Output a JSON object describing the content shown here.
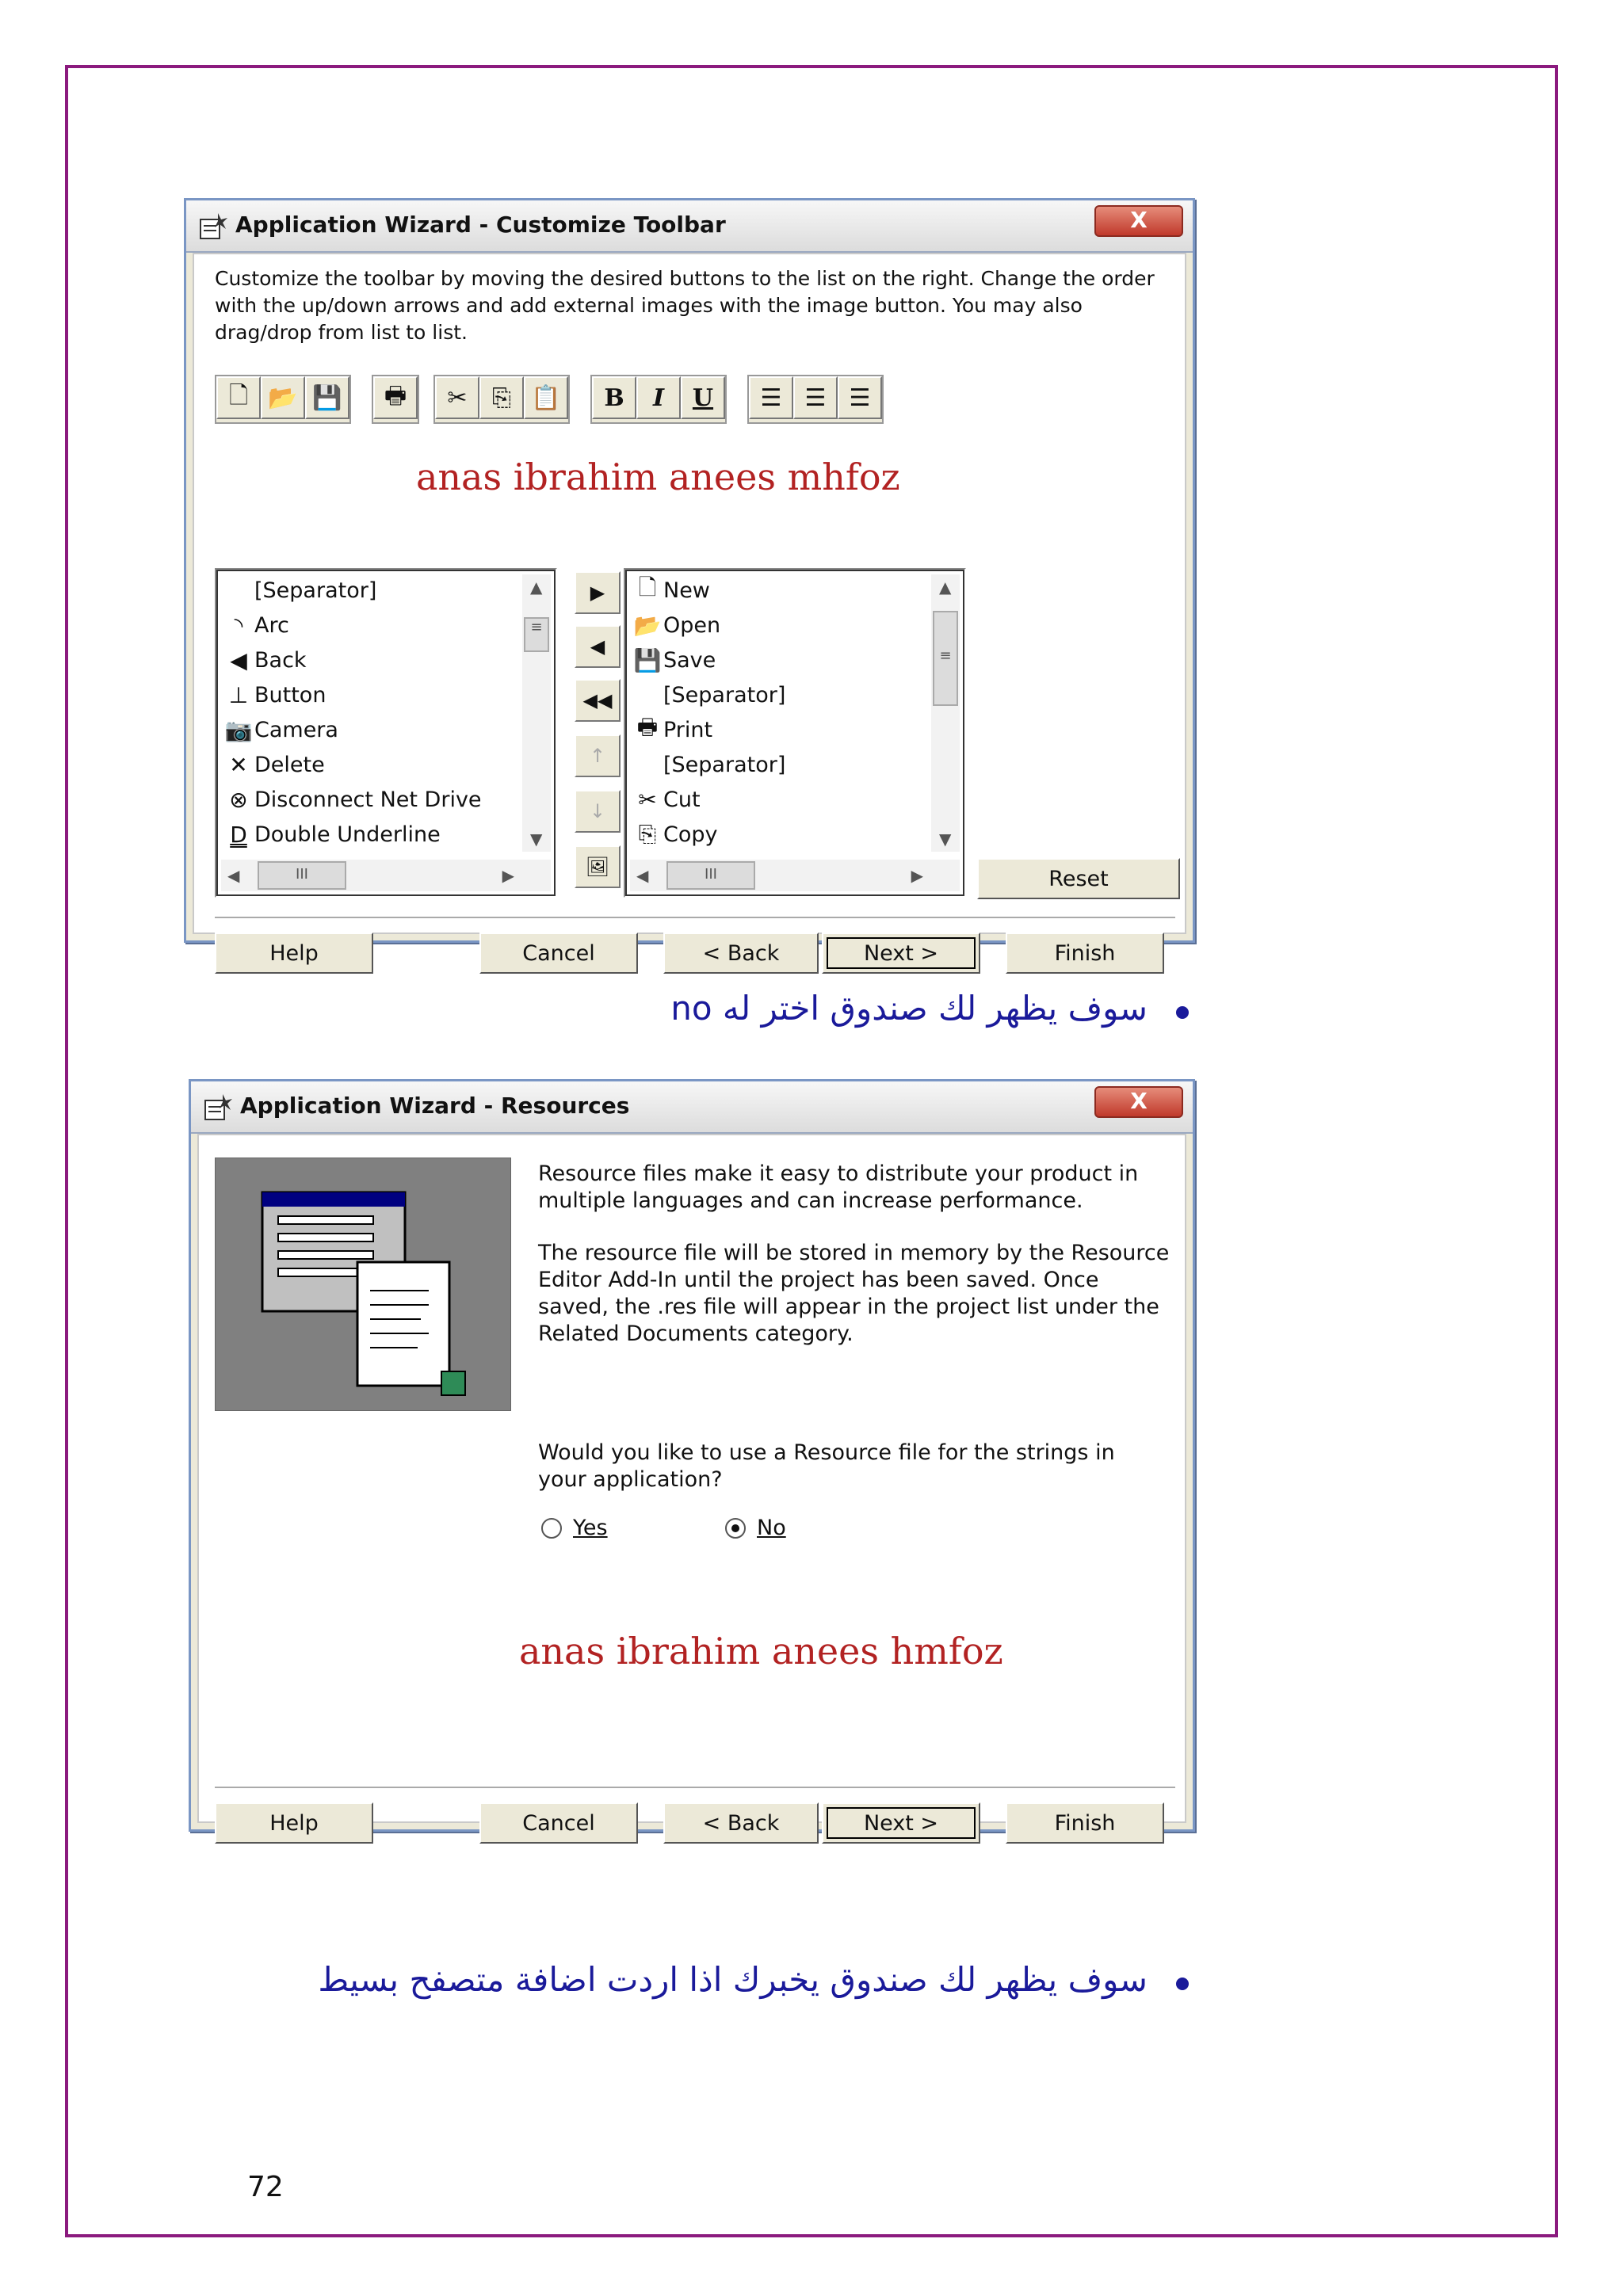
{
  "page_number": "72",
  "dialog1": {
    "title": "Application Wizard - Customize Toolbar",
    "close_label": "X",
    "intro_lines": [
      "Customize the toolbar by moving the desired buttons to the list on the right. Change the order",
      "with the up/down arrows and add external images with the image button. You may also",
      "drag/drop from list to list."
    ],
    "watermark": "anas ibrahim anees mhfoz",
    "toolbar_icons": [
      "new-doc-icon",
      "open-folder-icon",
      "save-icon",
      "print-icon",
      "cut-icon",
      "copy-icon",
      "paste-icon",
      "bold-icon",
      "italic-icon",
      "underline-icon",
      "align-left-icon",
      "align-center-icon",
      "align-right-icon"
    ],
    "left_list": [
      {
        "label": "[Separator]",
        "icon": ""
      },
      {
        "label": "Arc",
        "icon": "◝"
      },
      {
        "label": "Back",
        "icon": "◀"
      },
      {
        "label": "Button",
        "icon": "⊥"
      },
      {
        "label": "Camera",
        "icon": "📷"
      },
      {
        "label": "Delete",
        "icon": "✕"
      },
      {
        "label": "Disconnect Net Drive",
        "icon": "⊗"
      },
      {
        "label": "Double Underline",
        "icon": "D"
      }
    ],
    "right_list": [
      {
        "label": "New",
        "icon": "🗋"
      },
      {
        "label": "Open",
        "icon": "📂"
      },
      {
        "label": "Save",
        "icon": "💾"
      },
      {
        "label": "[Separator]",
        "icon": ""
      },
      {
        "label": "Print",
        "icon": "🖶"
      },
      {
        "label": "[Separator]",
        "icon": ""
      },
      {
        "label": "Cut",
        "icon": "✂"
      },
      {
        "label": "Copy",
        "icon": "⎘"
      }
    ],
    "reset_label": "Reset",
    "buttons": {
      "help": "Help",
      "cancel": "Cancel",
      "back": "< Back",
      "next": "Next >",
      "finish": "Finish"
    }
  },
  "bullet1": "سوف يظهر لك صندوق اختر له no",
  "dialog2": {
    "title": "Application Wizard - Resources",
    "close_label": "X",
    "para1": "Resource files make it easy to distribute your product in multiple languages and can increase performance.",
    "para2": "The resource file will be stored in memory by the Resource Editor Add-In until the project has been saved.  Once saved, the .res file will appear in the project list under the Related Documents category.",
    "question": "Would you like to use a Resource file for the strings in your application?",
    "radio_yes": "Yes",
    "radio_no": "No",
    "selected": "No",
    "watermark": "anas ibrahim anees hmfoz",
    "buttons": {
      "help": "Help",
      "cancel": "Cancel",
      "back": "< Back",
      "next": "Next >",
      "finish": "Finish"
    }
  },
  "bullet2": "سوف يظهر لك صندوق يخبرك اذا اردت اضافة متصفح بسيط"
}
